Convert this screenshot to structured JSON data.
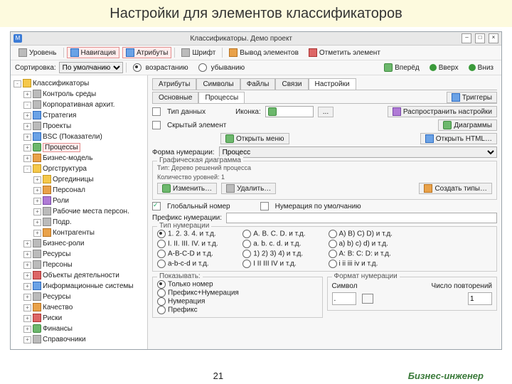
{
  "title_banner": "Настройки для элементов классификаторов",
  "window": {
    "caption": "Классификаторы. Демо проект",
    "close": "×",
    "max": "□",
    "min": "–"
  },
  "toolbar1": {
    "level": "Уровень",
    "nav": "Навигация",
    "attrs": "Атрибуты",
    "font": "Шрифт",
    "elements": "Вывод элементов",
    "mark": "Отметить элемент"
  },
  "toolbar2": {
    "sort_label": "Сортировка:",
    "sort_value": "По умолчанию",
    "asc": "возрастанию",
    "desc": "убыванию",
    "forward": "Вперёд",
    "up": "Вверх",
    "down": "Вниз"
  },
  "tree": {
    "root": "Классификаторы",
    "i1": "Контроль среды",
    "i2": "Корпоративная архит.",
    "i3": "Стратегия",
    "i4": "Проекты",
    "i5": "BSC (Показатели)",
    "i6": "Процессы",
    "i7": "Бизнес-модель",
    "i8": "Оргструктура",
    "i8a": "Оргединицы",
    "i8b": "Персонал",
    "i8c": "Роли",
    "i8d": "Рабочие места персон.",
    "i8e": "Подр.",
    "i8f": "Контрагенты",
    "i9": "Бизнес-роли",
    "i10": "Ресурсы",
    "i11": "Персоны",
    "i12": "Объекты деятельности",
    "i13": "Информационные системы",
    "i14": "Ресурсы",
    "i15": "Качество",
    "i16": "Риски",
    "i17": "Финансы",
    "i18": "Справочники"
  },
  "tabs": {
    "t1": "Атрибуты",
    "t2": "Символы",
    "t3": "Файлы",
    "t4": "Связи",
    "t5": "Настройки"
  },
  "subtabs": {
    "s1": "Основные",
    "s2": "Процессы"
  },
  "main": {
    "triggers": "Триггеры",
    "type_label": "Тип данных",
    "icon_label": "Иконка:",
    "icon_btn": "...",
    "propagate": "Распространить настройки",
    "hidden": "Скрытый элемент",
    "diagrams": "Диаграммы",
    "open_menu": "Открыть меню",
    "open_html": "Открыть HTML…",
    "form_label": "Форма нумерации:",
    "form_value": "Процесс",
    "graph_label": "Графическая диаграмма",
    "graph_type": "Тип: Дерево решений процесса",
    "level_count": "Количество уровней: 1",
    "edit": "Изменить…",
    "delete": "Удалить…",
    "create_types": "Создать типы…",
    "global_num": "Глобальный номер",
    "default_num": "Нумерация по умолчанию",
    "prefix_label": "Префикс нумерации:",
    "num_type_label": "Тип нумерации",
    "n1": "1. 2. 3. 4. и т.д.",
    "n2": "A. B. C. D. и т.д.",
    "n3": "A) B) C) D) и т.д.",
    "n4": "I. II. III. IV. и т.д.",
    "n5": "a. b. c. d. и т.д.",
    "n6": "a) b) c) d) и т.д.",
    "n7": "A-B-C-D и т.д.",
    "n8": "1) 2) 3) 4) и т.д.",
    "n9": "A: B: C: D: и т.д.",
    "n10": "a-b-c-d и т.д.",
    "n11": "I II III IV и т.д.",
    "n12": "i ii iii iv и т.д.",
    "show_label": "Показывать:",
    "format_label": "Формат нумерации",
    "r_only_num": "Только номер",
    "r_prefix_num": "Префикс+Нумерация",
    "r_num": "Нумерация",
    "r_prefix": "Префикс",
    "symbol_label": "Символ",
    "repeat_label": "Число повторений",
    "repeat_value": "1",
    "symbol_value": "."
  },
  "footer": {
    "page_num": "21",
    "brand": "Бизнес-инженер"
  }
}
